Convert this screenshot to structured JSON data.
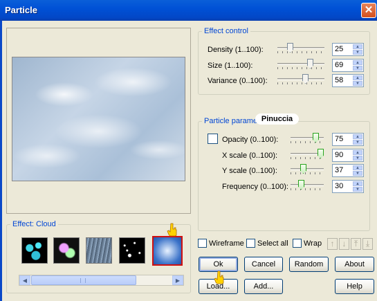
{
  "window": {
    "title": "Particle",
    "close_icon": "close-x-icon"
  },
  "effect_panel": {
    "legend": "Effect: Cloud",
    "thumbnails": [
      {
        "name": "bubbles-cyan"
      },
      {
        "name": "bubbles-pastel"
      },
      {
        "name": "rain-streaks"
      },
      {
        "name": "stars"
      },
      {
        "name": "cloud",
        "selected": true
      }
    ]
  },
  "effect_control": {
    "legend": "Effect control",
    "rows": [
      {
        "label": "Density (1..100):",
        "value": "25",
        "slider_fraction": 0.25
      },
      {
        "label": "Size (1..100):",
        "value": "69",
        "slider_fraction": 0.69
      },
      {
        "label": "Variance (0..100):",
        "value": "58",
        "slider_fraction": 0.58
      }
    ]
  },
  "particle_parameters": {
    "legend": "Particle paramete",
    "color_checked": false,
    "rows": [
      {
        "label": "Opacity (0..100):",
        "value": "75",
        "slider_fraction": 0.75
      },
      {
        "label": "X scale (0..100):",
        "value": "90",
        "slider_fraction": 0.9
      },
      {
        "label": "Y scale (0..100):",
        "value": "37",
        "slider_fraction": 0.37
      },
      {
        "label": "Frequency (0..100):",
        "value": "30",
        "slider_fraction": 0.3
      }
    ]
  },
  "watermark": "Pinuccia",
  "options": {
    "wireframe": "Wireframe",
    "select_all": "Select all",
    "wrap": "Wrap"
  },
  "buttons": {
    "ok": "Ok",
    "cancel": "Cancel",
    "random": "Random",
    "about": "About",
    "load": "Load...",
    "add": "Add...",
    "help": "Help"
  },
  "colors": {
    "accent": "#0046d5",
    "title_bar": "#0051d6",
    "selected_border": "#d01010"
  }
}
